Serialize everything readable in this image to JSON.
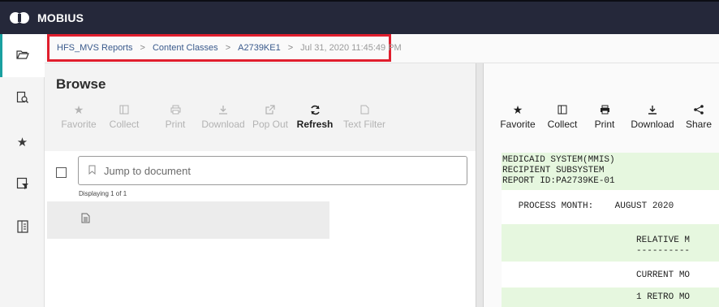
{
  "app": {
    "title": "MOBIUS"
  },
  "sidebar": {
    "items": [
      {
        "name": "folder-open-icon",
        "glyph": "🗁",
        "active": true
      },
      {
        "name": "document-search-icon",
        "glyph": "🔍",
        "active": false
      },
      {
        "name": "star-icon",
        "glyph": "★",
        "active": false
      },
      {
        "name": "document-filter-icon",
        "glyph": "⊟",
        "active": false
      },
      {
        "name": "report-icon",
        "glyph": "▤",
        "active": false
      }
    ]
  },
  "breadcrumb": {
    "items": [
      "HFS_MVS Reports",
      "Content Classes",
      "A2739KE1"
    ],
    "current": "Jul 31, 2020 11:45:49 PM",
    "separator": ">"
  },
  "browse": {
    "title": "Browse",
    "toolbar": [
      {
        "label": "Favorite",
        "icon": "star-icon",
        "glyph": "★",
        "enabled": false
      },
      {
        "label": "Collect",
        "icon": "collect-icon",
        "glyph": "▥",
        "enabled": false
      },
      {
        "label": "Print",
        "icon": "printer-icon",
        "glyph": "⎙",
        "enabled": false
      },
      {
        "label": "Download",
        "icon": "download-icon",
        "glyph": "⤓",
        "enabled": false
      },
      {
        "label": "Pop Out",
        "icon": "pop-out-icon",
        "glyph": "⧉",
        "enabled": false
      },
      {
        "label": "Refresh",
        "icon": "refresh-icon",
        "glyph": "⟳",
        "enabled": true
      },
      {
        "label": "Text Filter",
        "icon": "text-filter-icon",
        "glyph": "▯",
        "enabled": false
      }
    ],
    "jump_placeholder": "Jump to document",
    "displaying": "Displaying 1 of 1"
  },
  "viewer": {
    "toolbar": [
      {
        "label": "Favorite",
        "icon": "star-icon",
        "glyph": "★"
      },
      {
        "label": "Collect",
        "icon": "collect-icon",
        "glyph": "▥"
      },
      {
        "label": "Print",
        "icon": "printer-icon",
        "glyph": "⎙"
      },
      {
        "label": "Download",
        "icon": "download-icon",
        "glyph": "⤓"
      },
      {
        "label": "Share",
        "icon": "share-icon",
        "glyph": "⋖"
      }
    ],
    "report_lines": [
      "MEDICAID SYSTEM(MMIS)",
      "RECIPIENT SUBSYSTEM",
      "REPORT ID:PA2739KE-01",
      "   PROCESS MONTH:    AUGUST 2020",
      "                         RELATIVE M",
      "                         ----------",
      "                         CURRENT MO",
      "                         1 RETRO MO"
    ]
  },
  "colors": {
    "topbar": "#25283a",
    "highlight": "#e01e2d",
    "accent": "#1aa0a0",
    "report_band": "#e6f7df"
  }
}
